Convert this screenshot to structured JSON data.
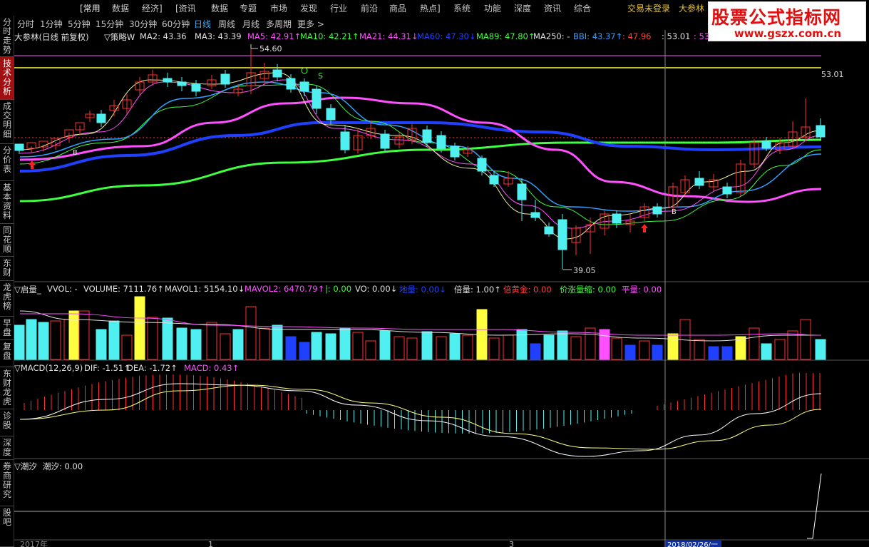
{
  "menubar": {
    "items": [
      "[常用",
      "数据",
      "经济]",
      "[资讯",
      "数据",
      "专题",
      "市场",
      "发现",
      "行业",
      "前沿",
      "商品",
      "热点]",
      "系统",
      "功能",
      "深度",
      "资讯",
      "综合"
    ],
    "login": "交易未登录",
    "stock_name": "大参林"
  },
  "watermark": {
    "title": "股票公式指标网",
    "url": "www.gszx.com.cn"
  },
  "sidebar": {
    "tabs": [
      "分时走势",
      "技术分析",
      "成交明细",
      "分价表",
      "基本资料",
      "同花顺",
      "东财",
      "龙虎榜",
      "早盘",
      "复盘",
      "东财龙虎",
      "诊股",
      "深度",
      "券商研究",
      "股吧"
    ],
    "active": "技术分析"
  },
  "periods": {
    "items": [
      "分时",
      "1分钟",
      "5分钟",
      "15分钟",
      "30分钟",
      "60分钟",
      "日线",
      "周线",
      "月线",
      "多周期",
      "更多 >"
    ],
    "active": "日线"
  },
  "main_legend": {
    "title": "大参林(日线 前复权)",
    "strategy": "▽策略W",
    "items": [
      {
        "text": "MA2: 43.36",
        "color": "#e0e0e0"
      },
      {
        "text": "MA3: 43.39",
        "color": "#e0e0e0"
      },
      {
        "text": "MA5: 42.91↑",
        "color": "#ff50ff"
      },
      {
        "text": "MA10: 42.21↑",
        "color": "#40ff40"
      },
      {
        "text": "MA21: 44.31↓",
        "color": "#ff50ff"
      },
      {
        "text": "MA60: 47.30↓",
        "color": "#2040ff"
      },
      {
        "text": "MA89: 47.80↑",
        "color": "#40ff40"
      },
      {
        "text": "MA250: -",
        "color": "#e0e0e0"
      },
      {
        "text": "BBI: 43.37↑",
        "color": "#30a0ff"
      },
      {
        "text": ": 47.96",
        "color": "#ff4040"
      },
      {
        "text": ": 53.01",
        "color": "#e0e0e0"
      },
      {
        "text": ": 53",
        "color": "#ff50ff"
      }
    ]
  },
  "price_labels": {
    "high": "54.60",
    "low": "39.05",
    "right": "53.01",
    "marker_b": "B",
    "marker_s": "S"
  },
  "volume_legend": {
    "title": "▽启量_",
    "items": [
      {
        "text": "VVOL: -",
        "color": "#e0e0e0"
      },
      {
        "text": "VOLUME: 7111.76↑",
        "color": "#e0e0e0"
      },
      {
        "text": "MAVOL1: 5154.10↓",
        "color": "#e0e0e0"
      },
      {
        "text": "MAVOL2: 6470.79↑",
        "color": "#ff50ff"
      },
      {
        "text": "|: 0.00",
        "color": "#40ff40"
      },
      {
        "text": "VO: 0.00↓",
        "color": "#e0e0e0"
      },
      {
        "text": "地量: 0.00↓",
        "color": "#2040ff"
      },
      {
        "text": "倍量: 1.00↑",
        "color": "#e0e0e0"
      },
      {
        "text": "倍黄金: 0.00",
        "color": "#ff4040"
      },
      {
        "text": "价涨量缩: 0.00",
        "color": "#40ff40"
      },
      {
        "text": "平量: 0.00",
        "color": "#ff50ff"
      }
    ]
  },
  "macd_legend": {
    "title": "▽MACD(12,26,9)",
    "items": [
      {
        "text": "DIF: -1.51↑",
        "color": "#e0e0e0"
      },
      {
        "text": "DEA: -1.72↑",
        "color": "#e0e0e0"
      },
      {
        "text": "MACD: 0.43↑",
        "color": "#ff50ff"
      }
    ]
  },
  "tide_legend": {
    "title": "▽潮汐",
    "items": [
      {
        "text": "潮汐: 0.00",
        "color": "#e0e0e0"
      }
    ]
  },
  "xaxis": {
    "labels": [
      "2017年",
      "1",
      "3"
    ],
    "cursor_date": "2018/02/26/一"
  },
  "colors": {
    "up": "#ff3030",
    "down": "#50f0f0",
    "ma5": "#ff50ff",
    "ma60": "#2040ff",
    "ma89": "#40ff40",
    "yellow": "#ffff40"
  }
}
